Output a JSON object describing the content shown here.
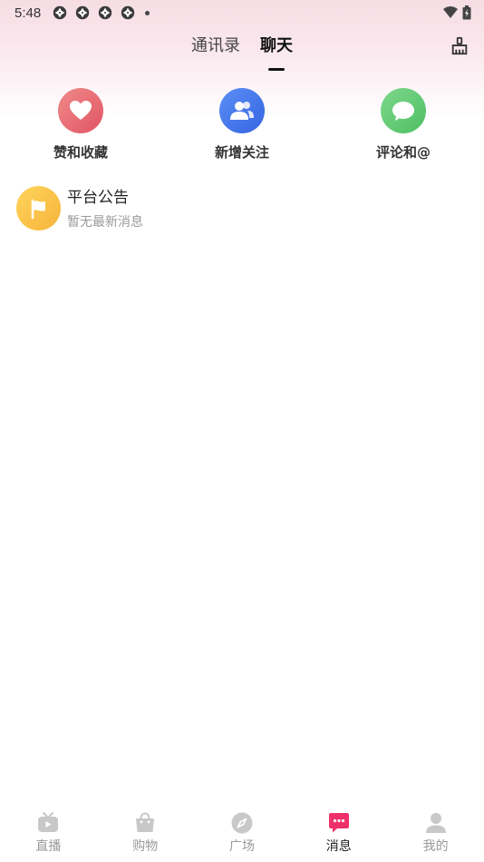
{
  "status_bar": {
    "time": "5:48",
    "app_icons": [
      "camera-aperture-icon",
      "camera-aperture-icon",
      "camera-aperture-icon",
      "camera-aperture-icon"
    ],
    "indicators": [
      "wifi-icon",
      "battery-charging-icon"
    ]
  },
  "header": {
    "tabs": [
      {
        "label": "通讯录",
        "active": false
      },
      {
        "label": "聊天",
        "active": true
      }
    ],
    "right_icon": "broom-clean-icon"
  },
  "quick_actions": [
    {
      "label": "赞和收藏",
      "icon": "heart-icon",
      "color": "#e05563"
    },
    {
      "label": "新增关注",
      "icon": "users-icon",
      "color": "#3664e2"
    },
    {
      "label": "评论和@",
      "icon": "chat-bubble-icon",
      "color": "#4fbf63"
    }
  ],
  "notice": {
    "title": "平台公告",
    "subtitle": "暂无最新消息",
    "icon": "flag-icon",
    "color": "#f6b43a"
  },
  "bottom_nav": {
    "items": [
      {
        "label": "直播",
        "icon": "tv-icon",
        "active": false
      },
      {
        "label": "购物",
        "icon": "shopping-bag-icon",
        "active": false
      },
      {
        "label": "广场",
        "icon": "compass-icon",
        "active": false
      },
      {
        "label": "消息",
        "icon": "message-icon",
        "active": true
      },
      {
        "label": "我的",
        "icon": "person-icon",
        "active": false
      }
    ],
    "active_color": "#f0306a",
    "inactive_color": "#c8c8c8"
  }
}
